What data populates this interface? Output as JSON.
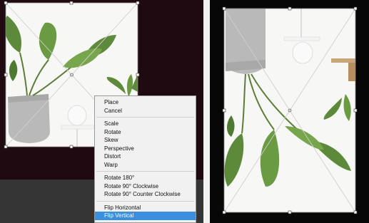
{
  "context_menu": {
    "groups": [
      [
        "Place",
        "Cancel"
      ],
      [
        "Scale",
        "Rotate",
        "Skew",
        "Perspective",
        "Distort",
        "Warp"
      ],
      [
        "Rotate 180°",
        "Rotate 90° Clockwise",
        "Rotate 90° Counter Clockwise"
      ],
      [
        "Flip Horizontal",
        "Flip Vertical"
      ]
    ],
    "selected": "Flip Vertical"
  },
  "colors": {
    "dark_background": "#1e0a10",
    "menu_highlight": "#3a8fde",
    "leaf_green": "#5d8a3a",
    "pot_gray": "#b9b9b9"
  }
}
